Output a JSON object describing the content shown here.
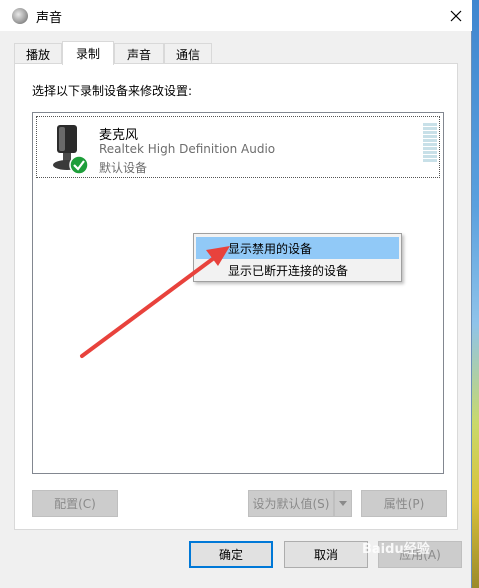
{
  "window": {
    "title": "声音",
    "close_glyph": "✕"
  },
  "tabs": [
    {
      "label": "播放",
      "active": false
    },
    {
      "label": "录制",
      "active": true
    },
    {
      "label": "声音",
      "active": false
    },
    {
      "label": "通信",
      "active": false
    }
  ],
  "panel": {
    "instruction": "选择以下录制设备来修改设置:"
  },
  "devices": [
    {
      "name": "麦克风",
      "driver": "Realtek High Definition Audio",
      "status": "默认设备",
      "icon": "microphone-icon",
      "badge": "default-check-icon"
    }
  ],
  "context_menu": {
    "items": [
      {
        "label": "显示禁用的设备",
        "highlighted": true
      },
      {
        "label": "显示已断开连接的设备",
        "highlighted": false
      }
    ]
  },
  "buttons": {
    "configure": "配置(C)",
    "set_default": "设为默认值(S)",
    "properties": "属性(P)",
    "ok": "确定",
    "cancel": "取消",
    "apply": "应用(A)"
  },
  "watermark": "Baidu经验",
  "colors": {
    "highlight": "#91c9f7",
    "check_green": "#1e9e3a",
    "annotation_arrow": "#e8423c",
    "default_button_border": "#0078d7"
  }
}
